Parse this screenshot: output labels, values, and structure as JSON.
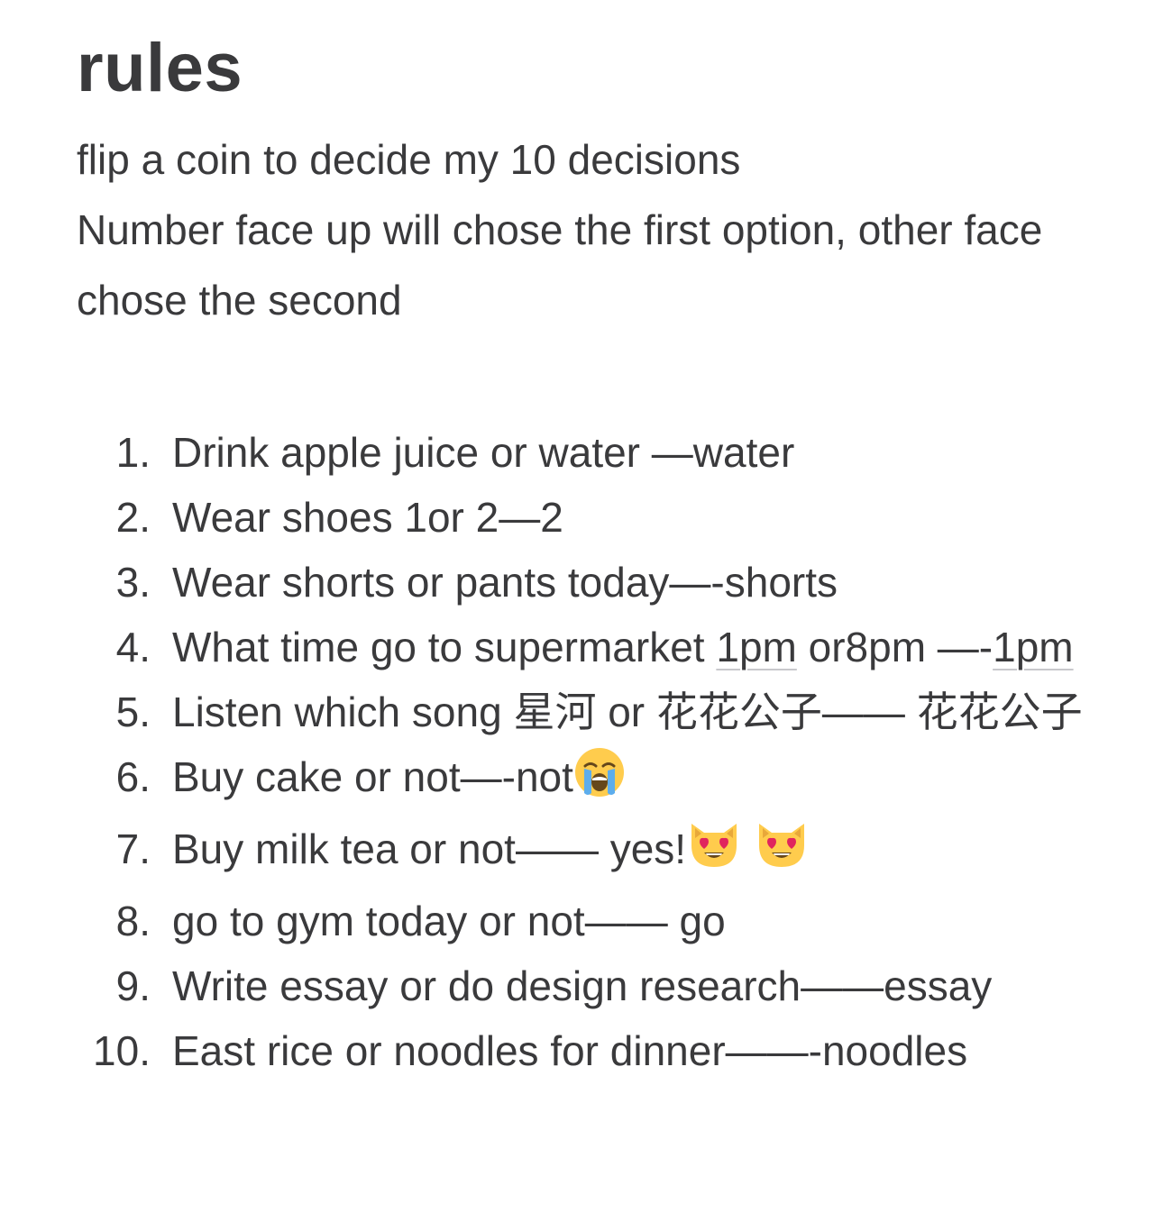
{
  "note": {
    "title": "rules",
    "intro": [
      "flip a coin to decide my 10 decisions",
      "Number face up will chose the first option, other face chose the second"
    ],
    "items": [
      {
        "num": "1.",
        "text": "Drink apple juice or water —water"
      },
      {
        "num": "2.",
        "text": "Wear shoes 1or 2—2"
      },
      {
        "num": "3.",
        "text": "Wear shorts or pants today—-shorts"
      },
      {
        "num": "4.",
        "text_before": "What time go to supermarket ",
        "link1": "1pm",
        "text_mid": " or8pm —-",
        "link2": "1pm"
      },
      {
        "num": "5.",
        "text": "Listen which song 星河 or 花花公子—— 花花公子"
      },
      {
        "num": "6.",
        "text": "Buy cake or not—-not"
      },
      {
        "num": "7.",
        "text": "Buy milk tea or not—— yes!"
      },
      {
        "num": "8.",
        "text": "go to gym today or not—— go"
      },
      {
        "num": "9.",
        "text": "Write essay or do design research——essay"
      },
      {
        "num": "10.",
        "text": "East rice or noodles for dinner——-noodles"
      }
    ],
    "emojis": {
      "crying": "loudly-crying-face-emoji",
      "heart_eyes_cat": "heart-eyes-cat-emoji"
    }
  }
}
